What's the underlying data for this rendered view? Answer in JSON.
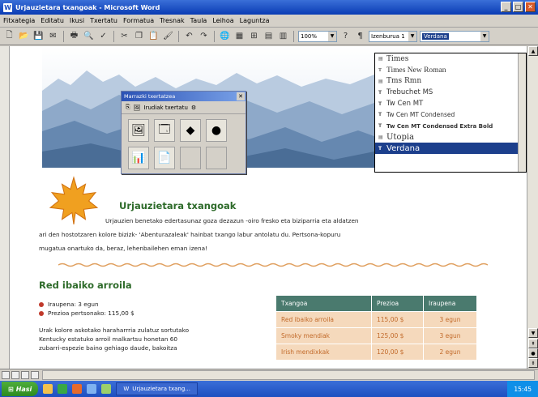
{
  "window": {
    "title": "Urjauzietara txangoak - Microsoft Word"
  },
  "menu": [
    "Fitxategia",
    "Editatu",
    "Ikusi",
    "Txertatu",
    "Formatua",
    "Tresnak",
    "Taula",
    "Leihoa",
    "Laguntza"
  ],
  "toolbar": {
    "zoom": "100%",
    "style": "Izenburua 1",
    "font": "Verdana"
  },
  "floating_toolbar": {
    "title": "Marrazki txertatzea",
    "label": "Irudiak txertatu"
  },
  "font_list": {
    "items": [
      {
        "name": "Times",
        "selected": false
      },
      {
        "name": "Times New Roman",
        "selected": false
      },
      {
        "name": "Tms Rmn",
        "selected": false
      },
      {
        "name": "Trebuchet MS",
        "selected": false
      },
      {
        "name": "Tw Cen MT",
        "selected": false
      },
      {
        "name": "Tw Cen MT Condensed",
        "selected": false
      },
      {
        "name": "Tw Cen MT Condensed Extra Bold",
        "selected": false
      },
      {
        "name": "Utopia",
        "selected": false
      },
      {
        "name": "Verdana",
        "selected": true
      }
    ]
  },
  "document": {
    "title": "Urjauzietara txangoak",
    "intro_line1": "Urjauzien benetako edertasunaz goza dezazun -oiro fresko eta biziparria eta aldatzen",
    "intro_line2": "ari den hostotzaren kolore bizizk- 'Abenturazaleak' hainbat txango labur antolatu du. Pertsona-kopuru",
    "intro_line3": "mugatua onartuko da, beraz, lehenbailehen eman izena!",
    "section_title": "Red ibaiko arroila",
    "bullets": [
      "Iraupena: 3 egun",
      "Prezioa pertsonako: 115,00 $"
    ],
    "body_line1": "Urak kolore askotako haraharrria zulatuz sortutako",
    "body_line2": "Kentucky estatuko arroil malkartsu honetan 60",
    "body_line3": "zubarri-espezie baino gehiago daude, bakoitza",
    "table": {
      "headers": [
        "Txangoa",
        "Prezioa",
        "Iraupena"
      ],
      "rows": [
        [
          "Red ibaiko arroila",
          "115,00 $",
          "3 egun"
        ],
        [
          "Smoky mendiak",
          "125,00 $",
          "3 egun"
        ],
        [
          "Irish mendixkak",
          "120,00 $",
          "2 egun"
        ]
      ]
    }
  },
  "taskbar": {
    "start": "Hasi",
    "task": "Urjauzietara txang...",
    "clock": "15:45"
  },
  "colors": {
    "heading": "#2e6b2a",
    "table_header": "#4a7a6e",
    "table_cell": "#f5d9bc",
    "selection": "#1c3f8c"
  }
}
